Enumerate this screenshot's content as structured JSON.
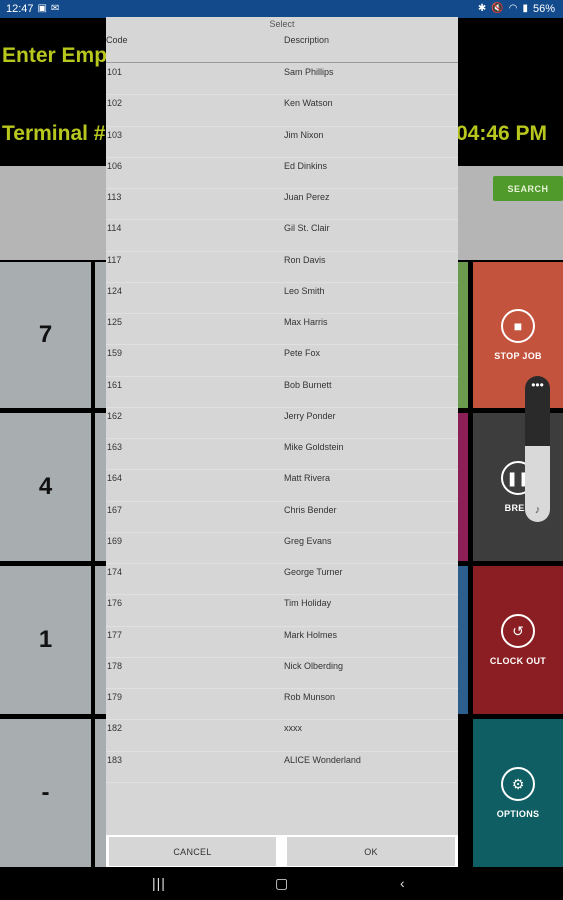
{
  "status_bar": {
    "time": "12:47",
    "battery": "56%"
  },
  "header": {
    "title": "Enter Emplo",
    "terminal": "Terminal #c",
    "clock": "04:46 PM"
  },
  "search_button": {
    "label": "SEARCH"
  },
  "keypad": {
    "keys": [
      "7",
      "4",
      "1",
      "-"
    ]
  },
  "tiles": [
    {
      "label": "STOP JOB",
      "icon": "stop-icon",
      "color": "#c4533d"
    },
    {
      "label": "BREA",
      "icon": "pause-icon",
      "color": "#3d3d3d"
    },
    {
      "label": "CLOCK OUT",
      "icon": "clock-out-icon",
      "color": "#8b1e22"
    },
    {
      "label": "OPTIONS",
      "icon": "gear-icon",
      "color": "#0f5e63"
    }
  ],
  "peek_colors": [
    "#6c9a4e",
    "#8b1f56",
    "#2d5f8e",
    "#000000"
  ],
  "volume": {
    "level": 0.52
  },
  "dialog": {
    "title": "Select",
    "columns": {
      "code": "Code",
      "description": "Description"
    },
    "rows": [
      {
        "code": "101",
        "description": "Sam Phillips"
      },
      {
        "code": "102",
        "description": "Ken Watson"
      },
      {
        "code": "103",
        "description": "Jim Nixon"
      },
      {
        "code": "106",
        "description": "Ed Dinkins"
      },
      {
        "code": "113",
        "description": "Juan Perez"
      },
      {
        "code": "114",
        "description": "Gil St. Clair"
      },
      {
        "code": "117",
        "description": "Ron Davis"
      },
      {
        "code": "124",
        "description": "Leo Smith"
      },
      {
        "code": "125",
        "description": "Max Harris"
      },
      {
        "code": "159",
        "description": "Pete Fox"
      },
      {
        "code": "161",
        "description": "Bob Burnett"
      },
      {
        "code": "162",
        "description": "Jerry Ponder"
      },
      {
        "code": "163",
        "description": "Mike Goldstein"
      },
      {
        "code": "164",
        "description": "Matt Rivera"
      },
      {
        "code": "167",
        "description": "Chris Bender"
      },
      {
        "code": "169",
        "description": "Greg Evans"
      },
      {
        "code": "174",
        "description": "George Turner"
      },
      {
        "code": "176",
        "description": "Tim Holiday"
      },
      {
        "code": "177",
        "description": "Mark Holmes"
      },
      {
        "code": "178",
        "description": "Nick Olberding"
      },
      {
        "code": "179",
        "description": "Rob Munson"
      },
      {
        "code": "182",
        "description": "xxxx"
      },
      {
        "code": "183",
        "description": "ALICE Wonderland"
      }
    ],
    "cancel_label": "CANCEL",
    "ok_label": "OK"
  },
  "navbar": {
    "recents_icon": "recents-icon",
    "home_icon": "home-icon",
    "back_icon": "back-icon"
  }
}
